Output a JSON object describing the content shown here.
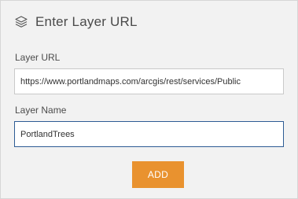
{
  "header": {
    "title": "Enter Layer URL",
    "icon": "layers-icon"
  },
  "form": {
    "url_label": "Layer URL",
    "url_value": "https://www.portlandmaps.com/arcgis/rest/services/Public",
    "name_label": "Layer Name",
    "name_value": "PortlandTrees"
  },
  "actions": {
    "add_label": "ADD"
  },
  "colors": {
    "panel_background": "#f2f2f2",
    "button_accent": "#e9922f",
    "focused_border": "#2e5c94"
  }
}
